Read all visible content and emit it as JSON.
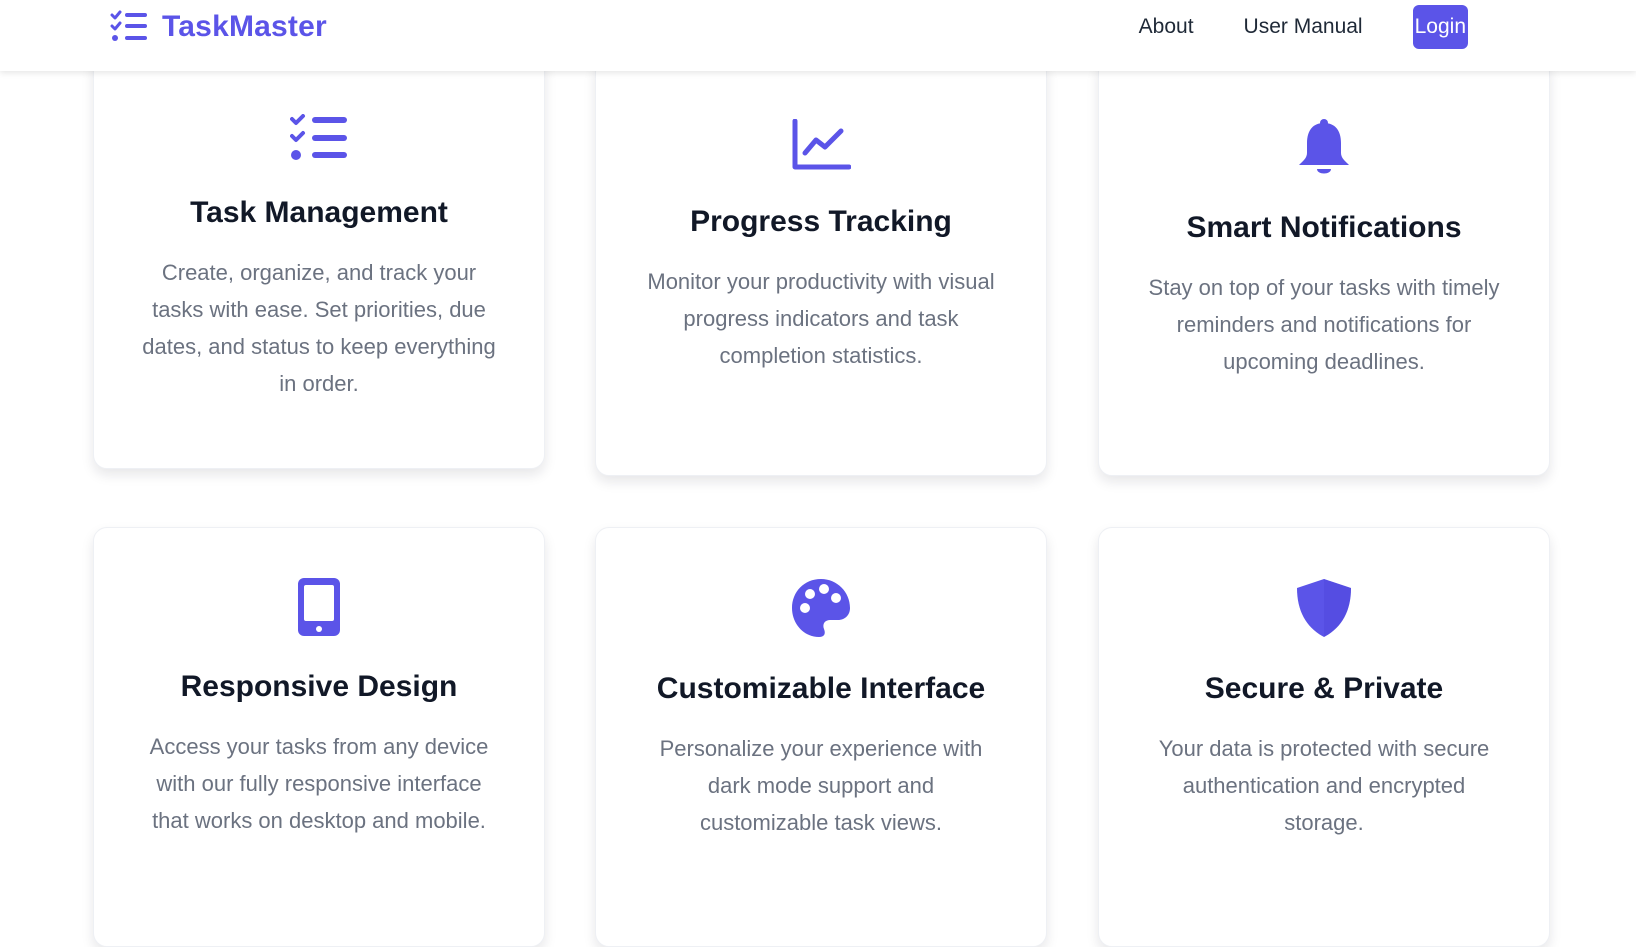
{
  "header": {
    "brand_name": "TaskMaster",
    "brand_icon": "task-list-icon",
    "nav": [
      {
        "label": "About"
      },
      {
        "label": "User Manual"
      }
    ],
    "login_label": "Login"
  },
  "features": [
    {
      "icon": "task-list-icon",
      "title": "Task Management",
      "description": "Create, organize, and track your tasks with ease. Set priorities, due dates, and status to keep everything in order."
    },
    {
      "icon": "chart-line-icon",
      "title": "Progress Tracking",
      "description": "Monitor your productivity with visual progress indicators and task completion statistics."
    },
    {
      "icon": "bell-icon",
      "title": "Smart Notifications",
      "description": "Stay on top of your tasks with timely reminders and notifications for upcoming deadlines."
    },
    {
      "icon": "mobile-phone-icon",
      "title": "Responsive Design",
      "description": "Access your tasks from any device with our fully responsive interface that works on desktop and mobile."
    },
    {
      "icon": "palette-icon",
      "title": "Customizable Interface",
      "description": "Personalize your experience with dark mode support and customizable task views."
    },
    {
      "icon": "shield-icon",
      "title": "Secure & Private",
      "description": "Your data is protected with secure authentication and encrypted storage."
    }
  ],
  "colors": {
    "accent": "#5B54E8",
    "heading": "#111827",
    "body_text": "#6b7280",
    "nav_text": "#1f2937"
  }
}
